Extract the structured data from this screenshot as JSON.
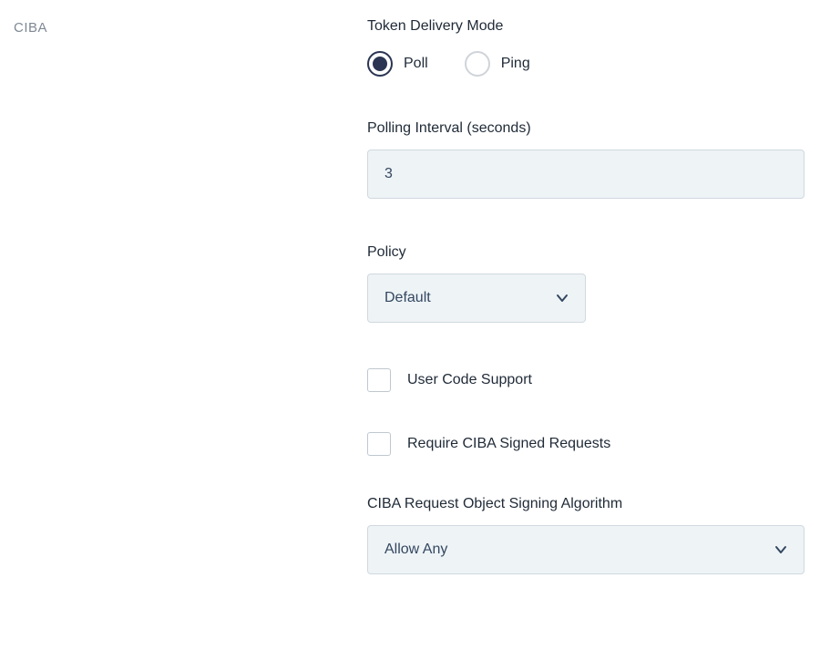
{
  "section": {
    "title": "CIBA"
  },
  "fields": {
    "tokenDeliveryMode": {
      "label": "Token Delivery Mode",
      "options": {
        "poll": "Poll",
        "ping": "Ping"
      },
      "selected": "poll"
    },
    "pollingInterval": {
      "label": "Polling Interval (seconds)",
      "value": "3"
    },
    "policy": {
      "label": "Policy",
      "selected": "Default"
    },
    "userCodeSupport": {
      "label": "User Code Support",
      "checked": false
    },
    "requireSignedRequests": {
      "label": "Require CIBA Signed Requests",
      "checked": false
    },
    "signingAlgorithm": {
      "label": "CIBA Request Object Signing Algorithm",
      "selected": "Allow Any"
    }
  }
}
